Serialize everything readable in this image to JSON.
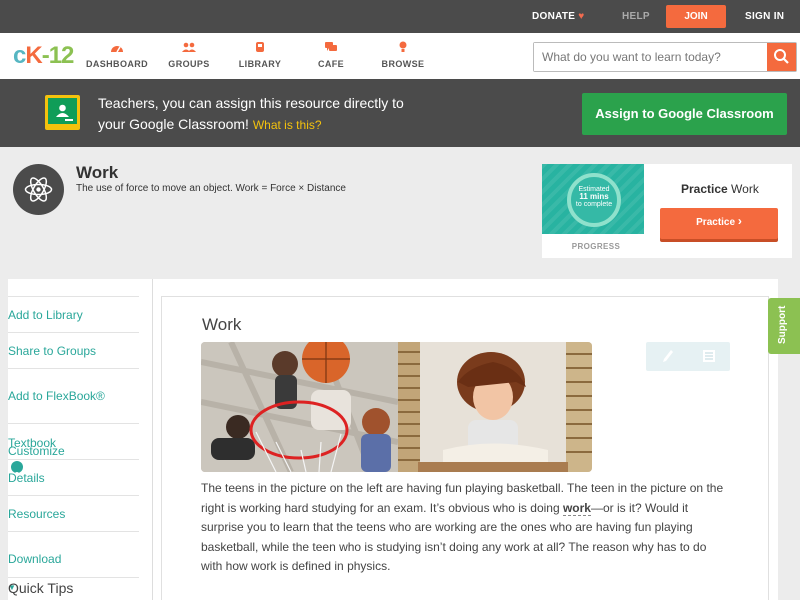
{
  "topbar": {
    "donate": "DONATE",
    "help": "HELP",
    "join": "JOIN",
    "signin": "SIGN IN"
  },
  "nav": {
    "logo": {
      "c": "c",
      "k": "K",
      "dash": "-",
      "num": "12"
    },
    "items": [
      {
        "label": "DASHBOARD",
        "icon": "dashboard-icon"
      },
      {
        "label": "GROUPS",
        "icon": "groups-icon"
      },
      {
        "label": "LIBRARY",
        "icon": "library-icon"
      },
      {
        "label": "CAFE",
        "icon": "cafe-icon"
      },
      {
        "label": "BROWSE",
        "icon": "browse-icon"
      }
    ],
    "search_placeholder": "What do you want to learn today?"
  },
  "banner": {
    "line1": "Teachers, you can assign this resource directly to",
    "line2": "your Google Classroom!",
    "what": "What is this?",
    "assign": "Assign to Google Classroom"
  },
  "concept": {
    "title": "Work",
    "description": "The use of force to move an object. Work = Force × Distance"
  },
  "practice": {
    "est_line1": "Estimated",
    "est_mins": "11 mins",
    "est_line3": "to complete",
    "progress_label": "PROGRESS",
    "heading_bold": "Practice",
    "heading_rest": " Work",
    "button": "Practice"
  },
  "sidebar": {
    "items": [
      "Add to Library",
      "Share to Groups",
      "Add to FlexBook®",
      "Textbook",
      "Customize",
      "Details",
      "Resources",
      "Download"
    ],
    "quick_tips": "Quick Tips"
  },
  "content": {
    "title": "Work",
    "p_before": "The teens in the picture on the left are having fun playing basketball. The teen in the picture on the right is working hard studying for an exam. It’s obvious who is doing ",
    "keyword": "work",
    "p_after": "—or is it? Would it surprise you to learn that the teens who are working are the ones who are having fun playing basketball, while the teen who is studying isn’t doing any work at all? The reason why has to do with how work is defined in physics."
  },
  "support": "Support",
  "colors": {
    "accent_orange": "#f46a3e",
    "teal": "#2aa79a",
    "green": "#2ba24c",
    "dark_bar": "#4b4b4b"
  }
}
